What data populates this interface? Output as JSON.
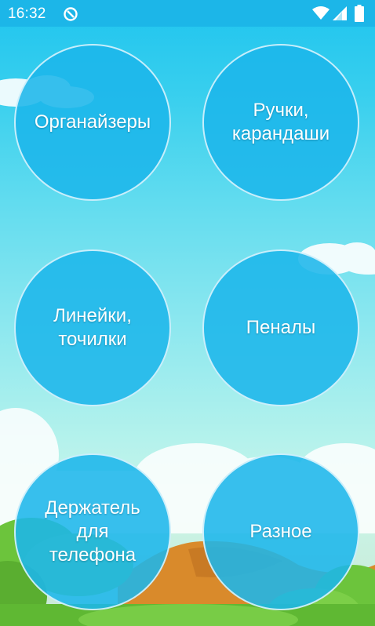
{
  "status_bar": {
    "time": "16:32",
    "icons": [
      "sync-icon",
      "wifi-icon",
      "signal-icon",
      "battery-icon"
    ]
  },
  "categories": [
    {
      "label": "Органайзеры"
    },
    {
      "label": "Ручки,\nкарандаши"
    },
    {
      "label": "Линейки,\nточилки"
    },
    {
      "label": "Пеналы"
    },
    {
      "label": "Держатель\nдля\nтелефона"
    },
    {
      "label": "Разное"
    }
  ],
  "colors": {
    "statusbar": "#1cb6e8",
    "tile": "#1db6eb",
    "sky_top": "#1fc4ef",
    "hill": "#d98a2b",
    "grass": "#6cc43c"
  }
}
